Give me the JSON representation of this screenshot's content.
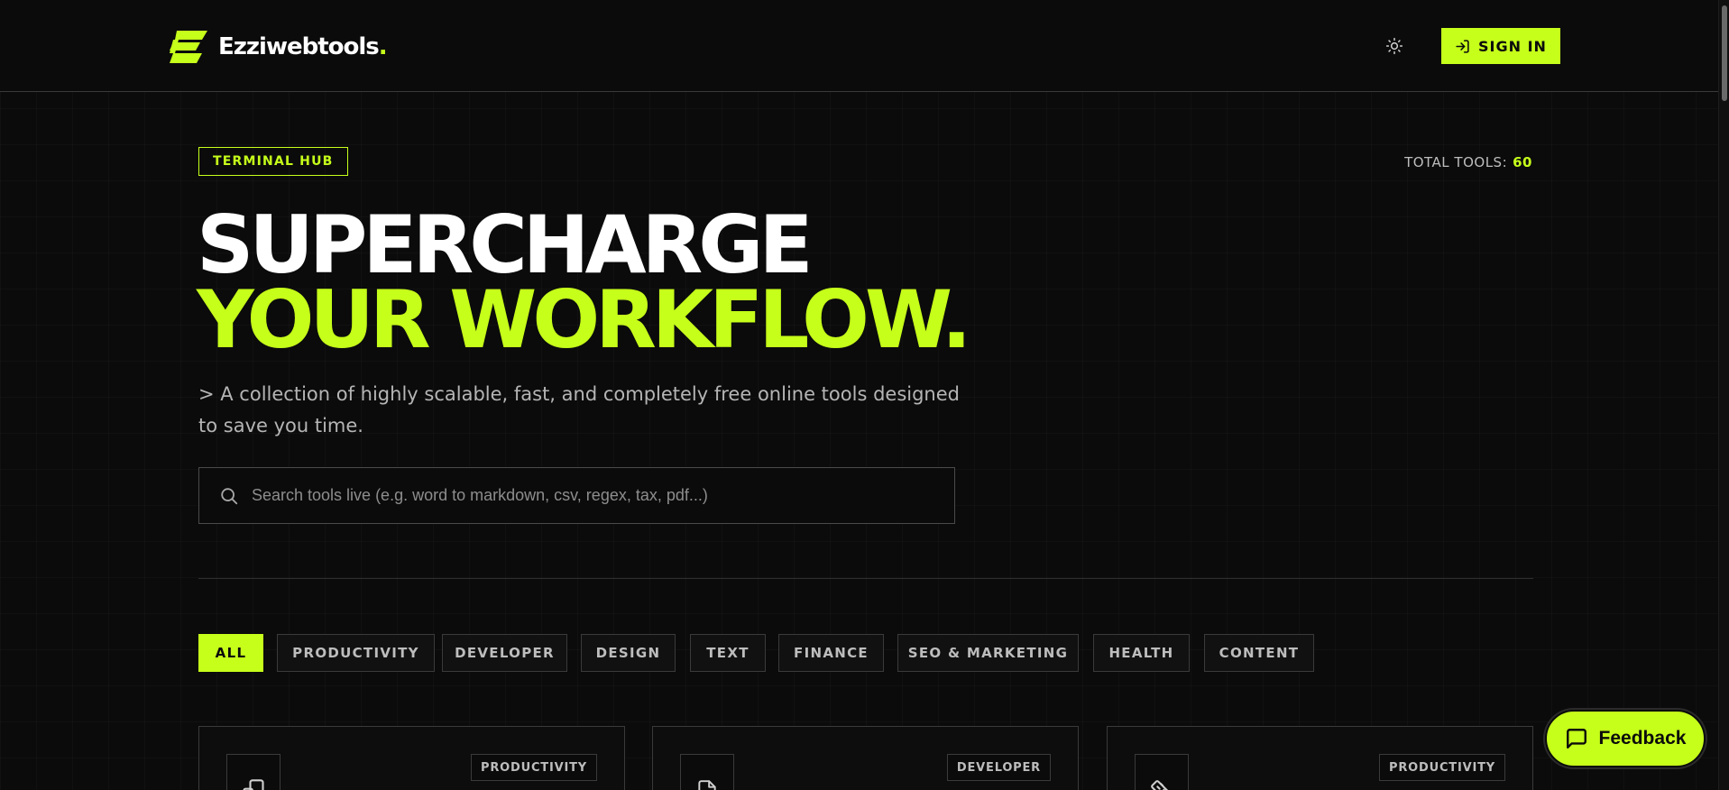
{
  "header": {
    "brand": "Ezziwebtools",
    "brand_dot": ".",
    "theme_icon": "sun-icon",
    "signin_label": "SIGN IN",
    "signin_icon": "login-icon"
  },
  "hero": {
    "badge": "TERMINAL HUB",
    "total_label": "TOTAL TOOLS:",
    "total_value": "60",
    "headline_line1": "SUPERCHARGE",
    "headline_line2": "YOUR WORKFLOW.",
    "subtitle": "> A collection of highly scalable, fast, and completely free online tools designed to save you time.",
    "search_placeholder": "Search tools live (e.g. word to markdown, csv, regex, tax, pdf...)",
    "search_value": ""
  },
  "filters": {
    "items": [
      {
        "label": "ALL",
        "active": true
      },
      {
        "label": "PRODUCTIVITY",
        "active": false
      },
      {
        "label": "DEVELOPER",
        "active": false
      },
      {
        "label": "DESIGN",
        "active": false
      },
      {
        "label": "TEXT",
        "active": false
      },
      {
        "label": "FINANCE",
        "active": false
      },
      {
        "label": "SEO & MARKETING",
        "active": false
      },
      {
        "label": "HEALTH",
        "active": false
      },
      {
        "label": "CONTENT",
        "active": false
      }
    ]
  },
  "cards": [
    {
      "category": "PRODUCTIVITY",
      "icon": "devices-icon"
    },
    {
      "category": "DEVELOPER",
      "icon": "code-file-icon"
    },
    {
      "category": "PRODUCTIVITY",
      "icon": "ruler-icon"
    }
  ],
  "feedback": {
    "label": "Feedback",
    "icon": "chat-icon"
  },
  "colors": {
    "accent": "#c6ff1a",
    "background": "#0b0b0b",
    "border": "#3a3a3a"
  }
}
